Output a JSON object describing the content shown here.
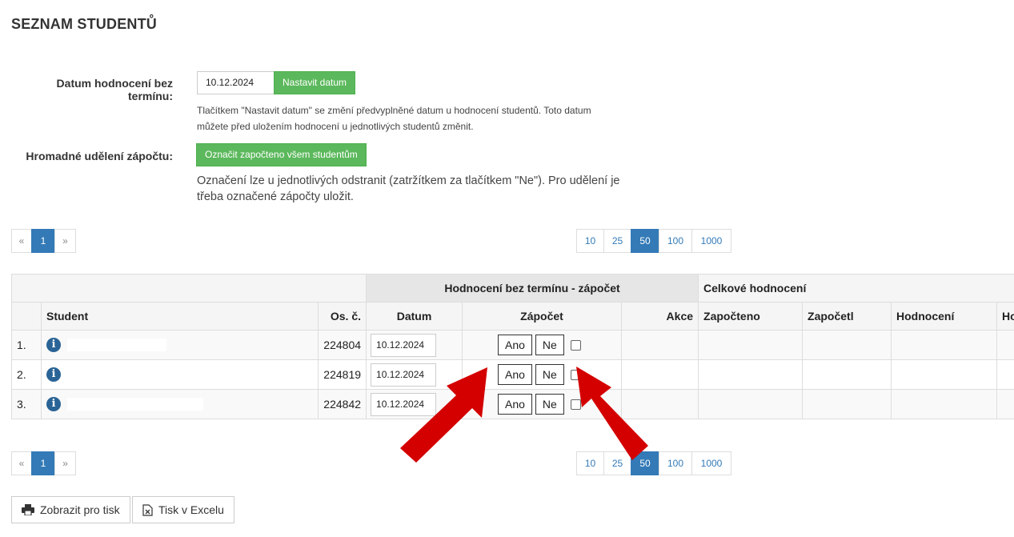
{
  "page_title": "SEZNAM STUDENTŮ",
  "date_section": {
    "label": "Datum hodnocení bez termínu:",
    "date_value": "10.12.2024",
    "set_button": "Nastavit datum",
    "help_line1": "Tlačítkem \"Nastavit datum\" se změní předvyplněné datum u hodnocení studentů. Toto datum",
    "help_line2": "můžete před uložením hodnocení u jednotlivých studentů změnit."
  },
  "bulk_section": {
    "label": "Hromadné udělení zápočtu:",
    "button": "Označit započteno všem studentům",
    "help_line1": "Označení lze u jednotlivých odstranit (zatržítkem za tlačítkem \"Ne\"). Pro udělení je",
    "help_line2": "třeba označené zápočty uložit."
  },
  "pagination": {
    "prev": "«",
    "current": "1",
    "next": "»"
  },
  "page_sizes": [
    "10",
    "25",
    "50",
    "100",
    "1000"
  ],
  "active_page_size": "50",
  "table": {
    "group_headers": {
      "without_term": "Hodnocení bez termínu - zápočet",
      "overall": "Celkové hodnocení"
    },
    "columns": {
      "student": "Student",
      "os_c": "Os. č.",
      "datum": "Datum",
      "zapocet": "Zápočet",
      "akce": "Akce",
      "zapocteno": "Započteno",
      "zapocetl": "Započetl",
      "hodnoceni": "Hodnocení",
      "ho": "Ho"
    },
    "rows": [
      {
        "index": "1.",
        "os_c": "224804",
        "date": "10.12.2024",
        "yes": "Ano",
        "no": "Ne"
      },
      {
        "index": "2.",
        "os_c": "224819",
        "date": "10.12.2024",
        "yes": "Ano",
        "no": "Ne"
      },
      {
        "index": "3.",
        "os_c": "224842",
        "date": "10.12.2024",
        "yes": "Ano",
        "no": "Ne"
      }
    ]
  },
  "footer_buttons": {
    "print": "Zobrazit pro tisk",
    "excel": "Tisk v Excelu"
  },
  "colors": {
    "primary": "#337ab7",
    "success": "#5cb85c",
    "arrow": "#d40000",
    "info_icon": "#2a6496"
  },
  "icons": {
    "info": "info-icon",
    "print": "printer-icon",
    "excel": "excel-file-icon"
  }
}
